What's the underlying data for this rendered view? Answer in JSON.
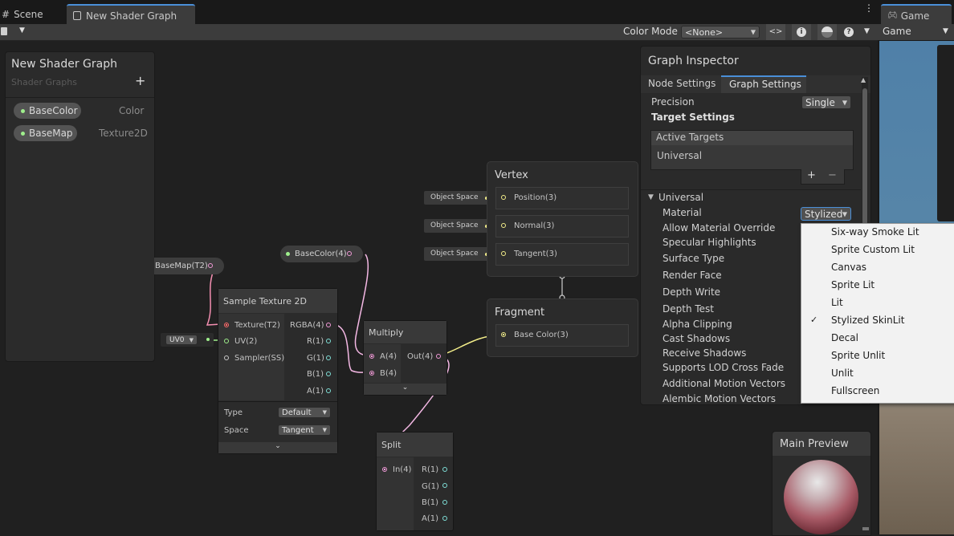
{
  "tabs": {
    "scene": "Scene",
    "shader_graph": "New Shader Graph",
    "game": "Game"
  },
  "toolbar": {
    "color_mode_label": "Color Mode",
    "color_mode_value": "<None>"
  },
  "game_panel": {
    "dropdown": "Game"
  },
  "blackboard": {
    "title": "New Shader Graph",
    "subtitle": "Shader Graphs",
    "add_icon": "+",
    "properties": [
      {
        "name": "BaseColor",
        "type": "Color"
      },
      {
        "name": "BaseMap",
        "type": "Texture2D"
      }
    ]
  },
  "nodes": {
    "basemap_prop": "BaseMap(T2)",
    "basecolor_prop": "BaseColor(4)",
    "uv_dropdown": "UV0",
    "sample_texture": {
      "title": "Sample Texture 2D",
      "inputs": [
        "Texture(T2)",
        "UV(2)",
        "Sampler(SS)"
      ],
      "outputs": [
        "RGBA(4)",
        "R(1)",
        "G(1)",
        "B(1)",
        "A(1)"
      ],
      "type_label": "Type",
      "type_value": "Default",
      "space_label": "Space",
      "space_value": "Tangent"
    },
    "multiply": {
      "title": "Multiply",
      "inputs": [
        "A(4)",
        "B(4)"
      ],
      "output": "Out(4)"
    },
    "split": {
      "title": "Split",
      "input": "In(4)",
      "outputs": [
        "R(1)",
        "G(1)",
        "B(1)",
        "A(1)"
      ]
    },
    "vertex": {
      "title": "Vertex",
      "slots": [
        "Position(3)",
        "Normal(3)",
        "Tangent(3)"
      ],
      "space_labels": [
        "Object Space",
        "Object Space",
        "Object Space"
      ]
    },
    "fragment": {
      "title": "Fragment",
      "slots": [
        "Base Color(3)"
      ]
    }
  },
  "inspector": {
    "title": "Graph Inspector",
    "tabs": [
      "Node Settings",
      "Graph Settings"
    ],
    "precision_label": "Precision",
    "precision_value": "Single",
    "target_settings": "Target Settings",
    "active_targets": "Active Targets",
    "universal_target": "Universal",
    "plus": "+",
    "minus": "−",
    "section": "Universal",
    "material_label": "Material",
    "material_value": "Stylized",
    "rows": [
      "Allow Material Override",
      "Specular Highlights",
      "Surface Type",
      "Render Face",
      "Depth Write",
      "Depth Test",
      "Alpha Clipping",
      "Cast Shadows",
      "Receive Shadows",
      "Supports LOD Cross Fade",
      "Additional Motion Vectors",
      "Alembic Motion Vectors"
    ]
  },
  "material_menu": {
    "items": [
      "Six-way Smoke Lit",
      "Sprite Custom Lit",
      "Canvas",
      "Sprite Lit",
      "Lit",
      "Stylized SkinLit",
      "Decal",
      "Sprite Unlit",
      "Unlit",
      "Fullscreen"
    ],
    "selected_index": 5,
    "check": "✓"
  },
  "main_preview": {
    "title": "Main Preview"
  }
}
